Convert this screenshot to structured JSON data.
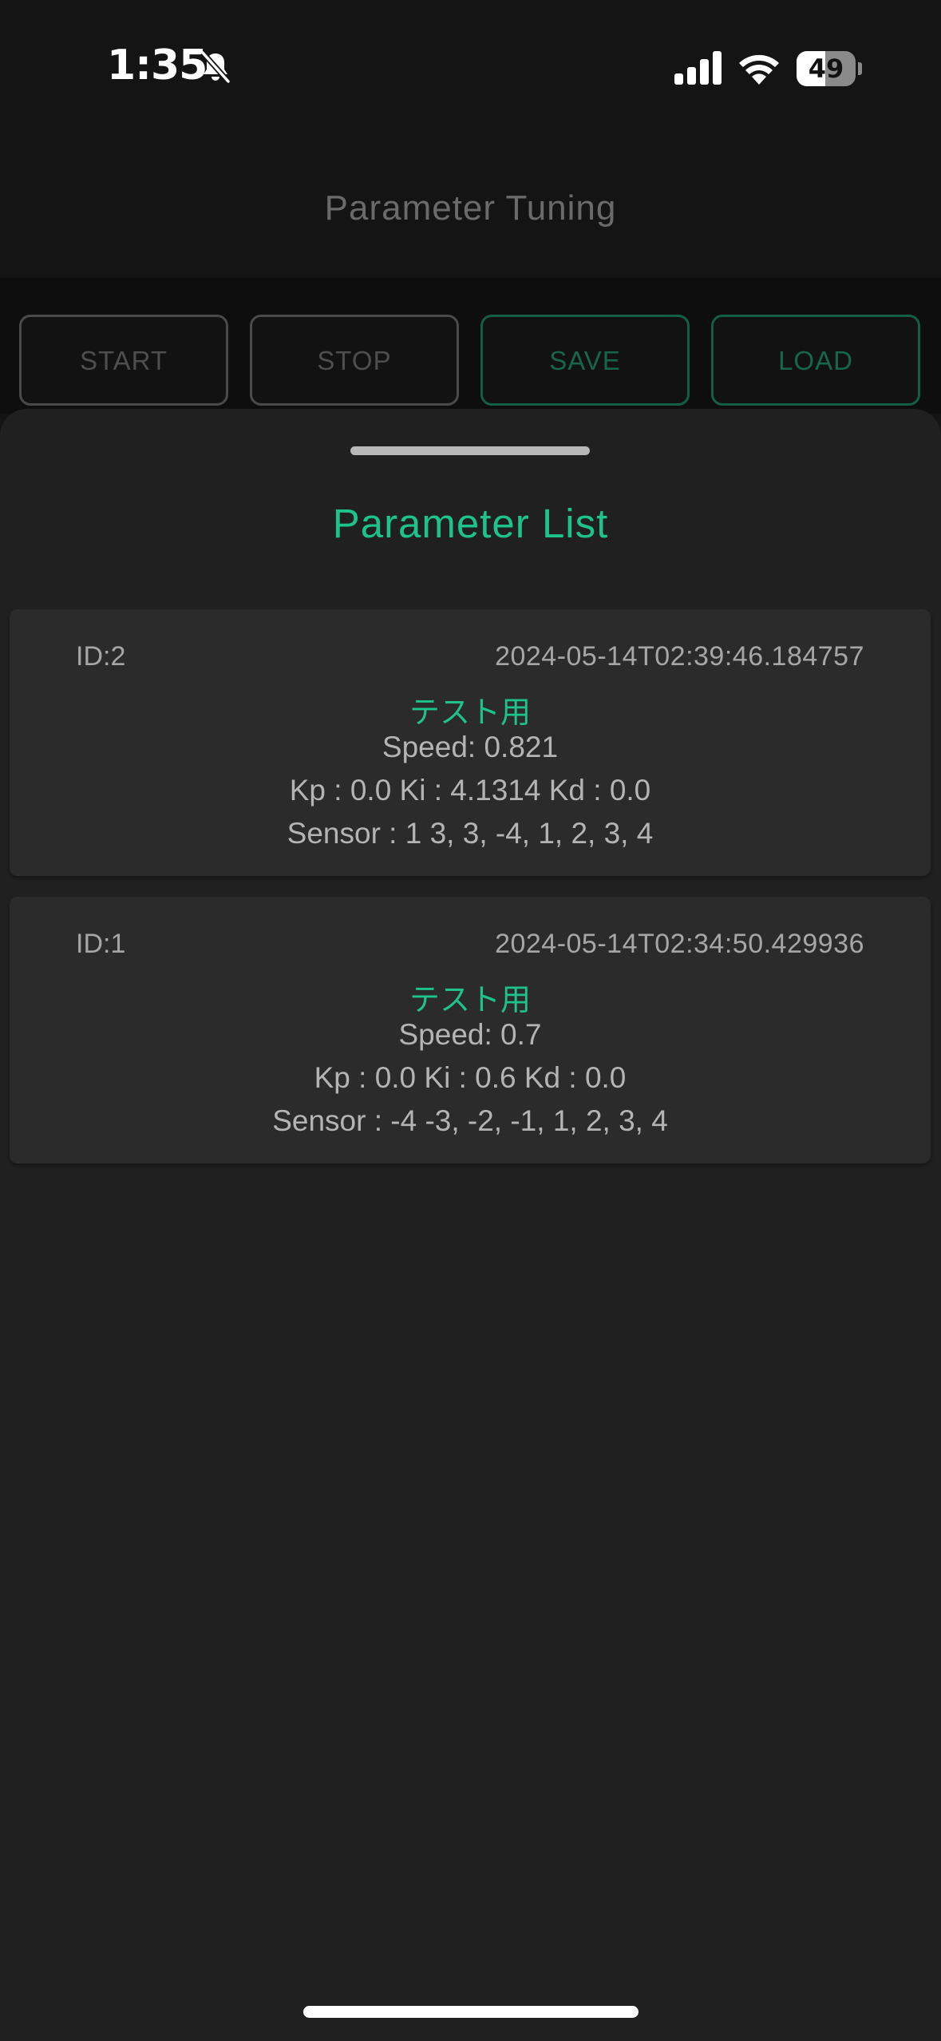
{
  "status_bar": {
    "time": "1:35",
    "battery_level": 49,
    "battery_text": "49",
    "icons": [
      "bell-slash-icon",
      "cellular-signal-icon",
      "wifi-icon",
      "battery-icon"
    ]
  },
  "app_bar": {
    "title": "Parameter Tuning"
  },
  "controls": {
    "start_label": "START",
    "stop_label": "STOP",
    "save_label": "SAVE",
    "load_label": "LOAD"
  },
  "sheet": {
    "title": "Parameter List",
    "items": [
      {
        "id": "ID:2",
        "timestamp": "2024-05-14T02:39:46.184757",
        "tag": "テスト用",
        "speed": "Speed: 0.821",
        "pid": "Kp : 0.0 Ki : 4.1314 Kd : 0.0",
        "sensor": "Sensor : 1 3, 3, -4, 1, 2, 3, 4"
      },
      {
        "id": "ID:1",
        "timestamp": "2024-05-14T02:34:50.429936",
        "tag": "テスト用",
        "speed": "Speed: 0.7",
        "pid": "Kp : 0.0 Ki : 0.6 Kd : 0.0",
        "sensor": "Sensor : -4 -3, -2, -1, 1, 2, 3, 4"
      }
    ]
  },
  "colors": {
    "accent": "#1ec28c",
    "background": "#141414",
    "sheet": "#202020",
    "card": "#2b2b2b"
  }
}
